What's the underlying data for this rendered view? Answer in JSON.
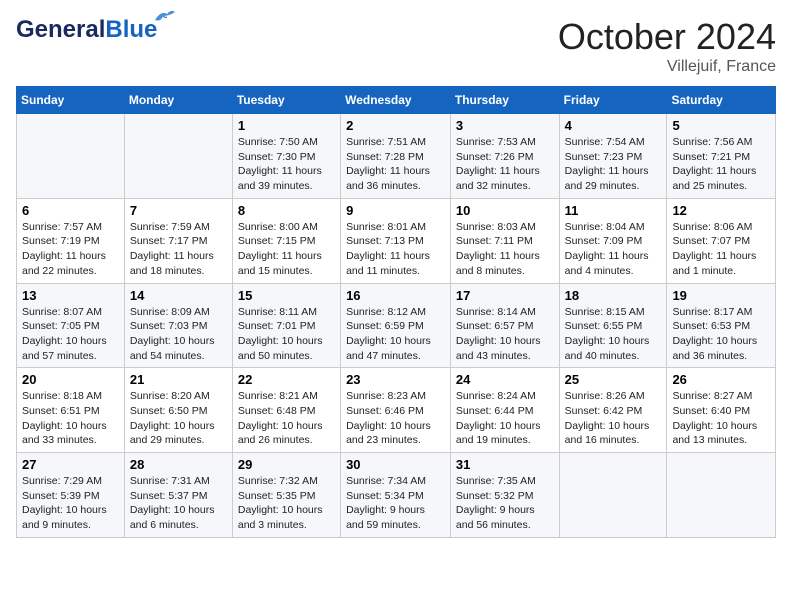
{
  "header": {
    "logo_general": "General",
    "logo_blue": "Blue",
    "month_title": "October 2024",
    "location": "Villejuif, France"
  },
  "columns": [
    "Sunday",
    "Monday",
    "Tuesday",
    "Wednesday",
    "Thursday",
    "Friday",
    "Saturday"
  ],
  "weeks": [
    [
      {
        "day": "",
        "info": ""
      },
      {
        "day": "",
        "info": ""
      },
      {
        "day": "1",
        "info": "Sunrise: 7:50 AM\nSunset: 7:30 PM\nDaylight: 11 hours and 39 minutes."
      },
      {
        "day": "2",
        "info": "Sunrise: 7:51 AM\nSunset: 7:28 PM\nDaylight: 11 hours and 36 minutes."
      },
      {
        "day": "3",
        "info": "Sunrise: 7:53 AM\nSunset: 7:26 PM\nDaylight: 11 hours and 32 minutes."
      },
      {
        "day": "4",
        "info": "Sunrise: 7:54 AM\nSunset: 7:23 PM\nDaylight: 11 hours and 29 minutes."
      },
      {
        "day": "5",
        "info": "Sunrise: 7:56 AM\nSunset: 7:21 PM\nDaylight: 11 hours and 25 minutes."
      }
    ],
    [
      {
        "day": "6",
        "info": "Sunrise: 7:57 AM\nSunset: 7:19 PM\nDaylight: 11 hours and 22 minutes."
      },
      {
        "day": "7",
        "info": "Sunrise: 7:59 AM\nSunset: 7:17 PM\nDaylight: 11 hours and 18 minutes."
      },
      {
        "day": "8",
        "info": "Sunrise: 8:00 AM\nSunset: 7:15 PM\nDaylight: 11 hours and 15 minutes."
      },
      {
        "day": "9",
        "info": "Sunrise: 8:01 AM\nSunset: 7:13 PM\nDaylight: 11 hours and 11 minutes."
      },
      {
        "day": "10",
        "info": "Sunrise: 8:03 AM\nSunset: 7:11 PM\nDaylight: 11 hours and 8 minutes."
      },
      {
        "day": "11",
        "info": "Sunrise: 8:04 AM\nSunset: 7:09 PM\nDaylight: 11 hours and 4 minutes."
      },
      {
        "day": "12",
        "info": "Sunrise: 8:06 AM\nSunset: 7:07 PM\nDaylight: 11 hours and 1 minute."
      }
    ],
    [
      {
        "day": "13",
        "info": "Sunrise: 8:07 AM\nSunset: 7:05 PM\nDaylight: 10 hours and 57 minutes."
      },
      {
        "day": "14",
        "info": "Sunrise: 8:09 AM\nSunset: 7:03 PM\nDaylight: 10 hours and 54 minutes."
      },
      {
        "day": "15",
        "info": "Sunrise: 8:11 AM\nSunset: 7:01 PM\nDaylight: 10 hours and 50 minutes."
      },
      {
        "day": "16",
        "info": "Sunrise: 8:12 AM\nSunset: 6:59 PM\nDaylight: 10 hours and 47 minutes."
      },
      {
        "day": "17",
        "info": "Sunrise: 8:14 AM\nSunset: 6:57 PM\nDaylight: 10 hours and 43 minutes."
      },
      {
        "day": "18",
        "info": "Sunrise: 8:15 AM\nSunset: 6:55 PM\nDaylight: 10 hours and 40 minutes."
      },
      {
        "day": "19",
        "info": "Sunrise: 8:17 AM\nSunset: 6:53 PM\nDaylight: 10 hours and 36 minutes."
      }
    ],
    [
      {
        "day": "20",
        "info": "Sunrise: 8:18 AM\nSunset: 6:51 PM\nDaylight: 10 hours and 33 minutes."
      },
      {
        "day": "21",
        "info": "Sunrise: 8:20 AM\nSunset: 6:50 PM\nDaylight: 10 hours and 29 minutes."
      },
      {
        "day": "22",
        "info": "Sunrise: 8:21 AM\nSunset: 6:48 PM\nDaylight: 10 hours and 26 minutes."
      },
      {
        "day": "23",
        "info": "Sunrise: 8:23 AM\nSunset: 6:46 PM\nDaylight: 10 hours and 23 minutes."
      },
      {
        "day": "24",
        "info": "Sunrise: 8:24 AM\nSunset: 6:44 PM\nDaylight: 10 hours and 19 minutes."
      },
      {
        "day": "25",
        "info": "Sunrise: 8:26 AM\nSunset: 6:42 PM\nDaylight: 10 hours and 16 minutes."
      },
      {
        "day": "26",
        "info": "Sunrise: 8:27 AM\nSunset: 6:40 PM\nDaylight: 10 hours and 13 minutes."
      }
    ],
    [
      {
        "day": "27",
        "info": "Sunrise: 7:29 AM\nSunset: 5:39 PM\nDaylight: 10 hours and 9 minutes."
      },
      {
        "day": "28",
        "info": "Sunrise: 7:31 AM\nSunset: 5:37 PM\nDaylight: 10 hours and 6 minutes."
      },
      {
        "day": "29",
        "info": "Sunrise: 7:32 AM\nSunset: 5:35 PM\nDaylight: 10 hours and 3 minutes."
      },
      {
        "day": "30",
        "info": "Sunrise: 7:34 AM\nSunset: 5:34 PM\nDaylight: 9 hours and 59 minutes."
      },
      {
        "day": "31",
        "info": "Sunrise: 7:35 AM\nSunset: 5:32 PM\nDaylight: 9 hours and 56 minutes."
      },
      {
        "day": "",
        "info": ""
      },
      {
        "day": "",
        "info": ""
      }
    ]
  ]
}
